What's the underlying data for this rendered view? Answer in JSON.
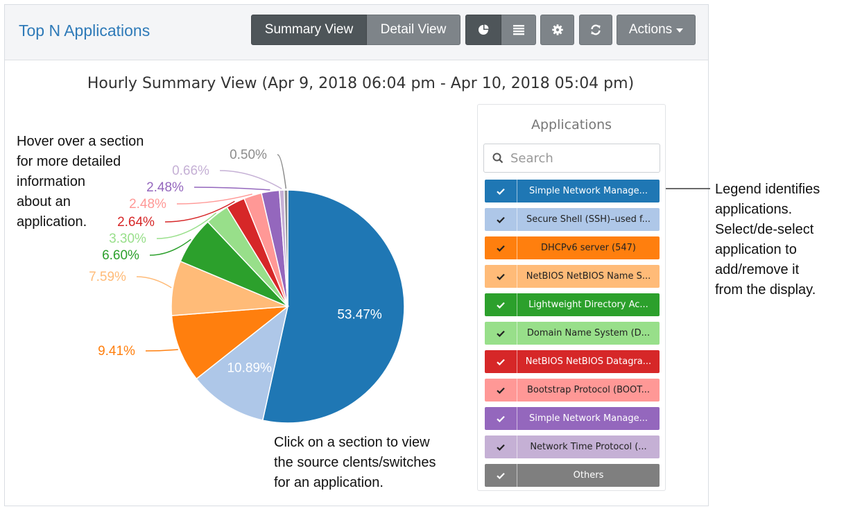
{
  "header": {
    "title": "Top N Applications",
    "summary_view_label": "Summary View",
    "detail_view_label": "Detail View",
    "actions_label": "Actions"
  },
  "chart_data": {
    "type": "pie",
    "title": "Hourly Summary View (Apr 9, 2018 06:04 pm - Apr 10, 2018 05:04 pm)",
    "slices": [
      {
        "value": 53.47,
        "label": "53.47%",
        "color": "#1f77b4"
      },
      {
        "value": 10.89,
        "label": "10.89%",
        "color": "#aec7e8"
      },
      {
        "value": 9.41,
        "label": "9.41%",
        "color": "#ff7f0e"
      },
      {
        "value": 7.59,
        "label": "7.59%",
        "color": "#ffbb78"
      },
      {
        "value": 6.6,
        "label": "6.60%",
        "color": "#2ca02c"
      },
      {
        "value": 3.3,
        "label": "3.30%",
        "color": "#98df8a"
      },
      {
        "value": 2.64,
        "label": "2.64%",
        "color": "#d62728"
      },
      {
        "value": 2.48,
        "label": "2.48%",
        "color": "#ff9896"
      },
      {
        "value": 2.48,
        "label": "2.48%",
        "color": "#9467bd"
      },
      {
        "value": 0.66,
        "label": "0.66%",
        "color": "#c5b0d5"
      },
      {
        "value": 0.5,
        "label": "0.50%",
        "color": "#8c8c8c"
      }
    ]
  },
  "legend": {
    "heading": "Applications",
    "search_placeholder": "Search",
    "items": [
      {
        "label": "Simple Network Manage...",
        "color": "#1f77b4",
        "text_color": "#ffffff"
      },
      {
        "label": "Secure Shell (SSH)–used f...",
        "color": "#aec7e8",
        "text_color": "#222222"
      },
      {
        "label": "DHCPv6 server (547)",
        "color": "#ff7f0e",
        "text_color": "#222222"
      },
      {
        "label": "NetBIOS NetBIOS Name S...",
        "color": "#ffbb78",
        "text_color": "#222222"
      },
      {
        "label": "Lightweight Directory Ac...",
        "color": "#2ca02c",
        "text_color": "#ffffff"
      },
      {
        "label": "Domain Name System (D...",
        "color": "#98df8a",
        "text_color": "#222222"
      },
      {
        "label": "NetBIOS NetBIOS Datagra...",
        "color": "#d62728",
        "text_color": "#ffffff"
      },
      {
        "label": "Bootstrap Protocol (BOOT...",
        "color": "#ff9896",
        "text_color": "#222222"
      },
      {
        "label": "Simple Network Manage...",
        "color": "#9467bd",
        "text_color": "#ffffff"
      },
      {
        "label": "Network Time Protocol (...",
        "color": "#c5b0d5",
        "text_color": "#222222"
      },
      {
        "label": "Others",
        "color": "#7f7f7f",
        "text_color": "#ffffff"
      }
    ]
  },
  "annotations": {
    "hover_note": "Hover over a section\nfor more detailed\ninformation\nabout an\napplication.",
    "click_note": "Click on a section to view\nthe source clents/switches\nfor an application.",
    "legend_note": "Legend identifies\napplications.\nSelect/de-select\napplication to\nadd/remove it\nfrom the display."
  },
  "icons": {
    "pie_view": "pie-chart-icon",
    "list_view": "list-icon",
    "settings": "gear-icon",
    "refresh": "refresh-icon",
    "search": "search-icon",
    "check": "check-icon"
  }
}
